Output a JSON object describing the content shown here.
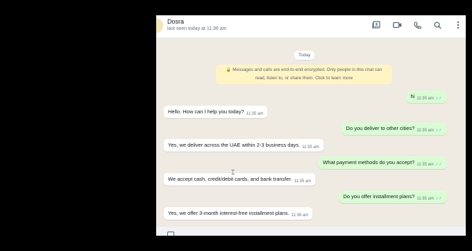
{
  "header": {
    "contact_name": "Dosra",
    "last_seen": "last seen today at 11:36 am",
    "icons": [
      "contact-card-icon",
      "video-call-icon",
      "phone-icon",
      "search-icon",
      "menu-dots-icon"
    ]
  },
  "chat": {
    "date_label": "Today",
    "encryption_notice_line1": "Messages and calls are end-to-end encrypted. Only people in this chat can",
    "encryption_notice_line2": "read, listen to, or share them. Click to learn more",
    "messages": [
      {
        "direction": "out",
        "text": "hi",
        "time": "11:35 am"
      },
      {
        "direction": "in",
        "text": "Hello. How can I help you today?",
        "time": "11:35 am"
      },
      {
        "direction": "out",
        "text": "Do you deliver to other cities?",
        "time": "11:35 am"
      },
      {
        "direction": "in",
        "text": "Yes, we deliver across the UAE within 2-3 business days.",
        "time": "11:35 am"
      },
      {
        "direction": "out",
        "text": "What payment methods do you accept?",
        "time": "11:35 am"
      },
      {
        "direction": "in",
        "text": "We accept cash, credit/debit cards, and bank transfer.",
        "time": "11:35 am"
      },
      {
        "direction": "out",
        "text": "Do you offer installment plans?",
        "time": "11:35 am"
      },
      {
        "direction": "in",
        "text": "Yes, we offer 3-month interest-free installment plans.",
        "time": "11:36 am"
      }
    ]
  },
  "colors": {
    "incoming_bubble": "#ffffff",
    "outgoing_bubble": "#d9fdd3",
    "chat_background": "#efeae2",
    "read_tick": "#53bdeb"
  }
}
